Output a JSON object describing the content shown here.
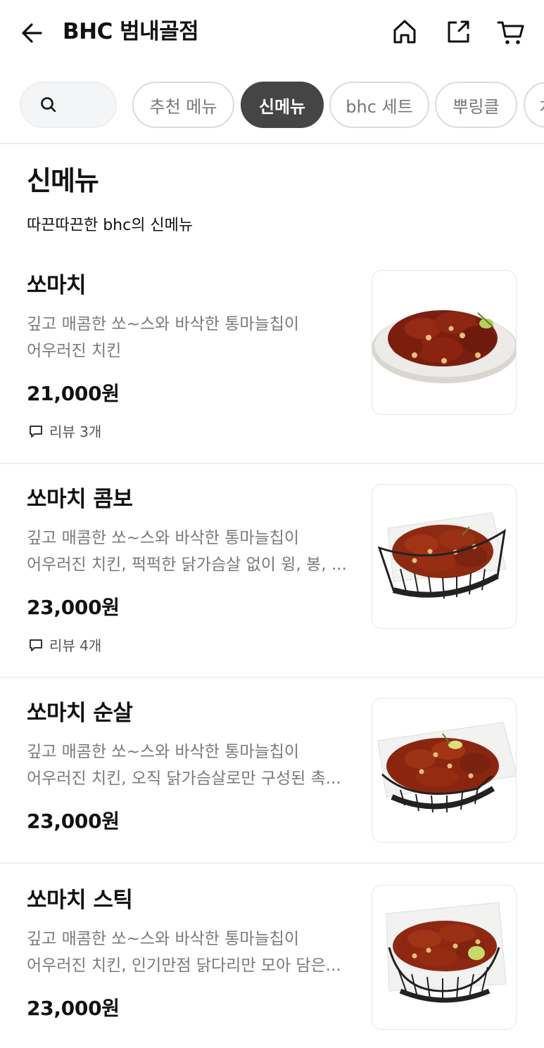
{
  "header": {
    "title": "BHC 범내골점"
  },
  "chips": [
    "추천 메뉴",
    "신메뉴",
    "bhc 세트",
    "뿌링클",
    "치"
  ],
  "active_chip": "신메뉴",
  "section": {
    "title": "신메뉴",
    "description": "따끈따끈한 bhc의 신메뉴"
  },
  "items": [
    {
      "name": "쏘마치",
      "desc_line1": "깊고 매콤한 쏘~스와 바삭한 통마늘칩이",
      "desc_line2": "어우러진 치킨",
      "price": "21,000원",
      "review": "리뷰 3개"
    },
    {
      "name": "쏘마치 콤보",
      "desc_line1": "깊고 매콤한 쏘~스와 바삭한 통마늘칩이",
      "desc_line2": "어우러진 치킨, 퍽퍽한 닭가슴살 없이 윙, 봉, ...",
      "price": "23,000원",
      "review": "리뷰 4개"
    },
    {
      "name": "쏘마치 순살",
      "desc_line1": "깊고 매콤한 쏘~스와 바삭한 통마늘칩이",
      "desc_line2": "어우러진 치킨, 오직 닭가슴살로만 구성된 촉...",
      "price": "23,000원"
    },
    {
      "name": "쏘마치 스틱",
      "desc_line1": "깊고 매콤한 쏘~스와 바삭한 통마늘칩이",
      "desc_line2": "어우러진 치킨, 인기만점 닭다리만 모아 담은...",
      "price": "23,000원"
    }
  ]
}
